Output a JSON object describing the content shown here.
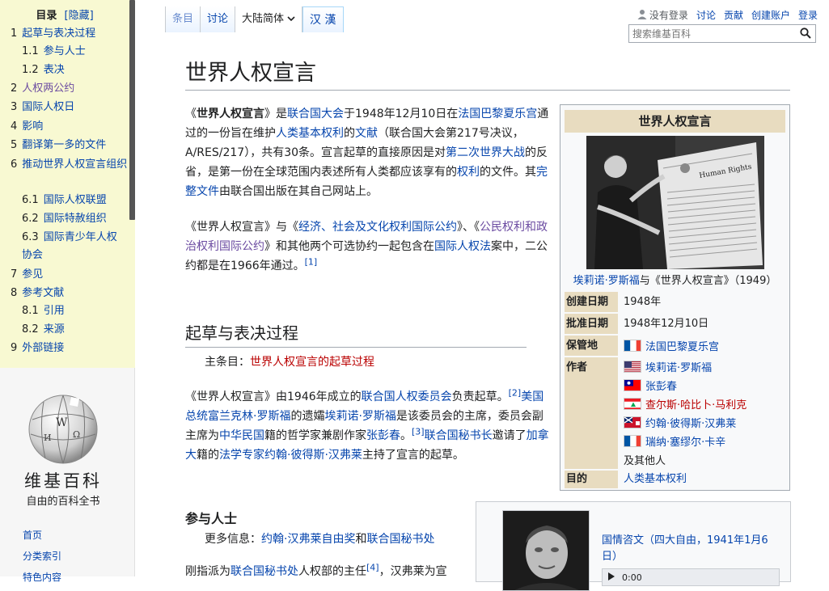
{
  "toc": {
    "title": "目录",
    "hide": "[隐藏]",
    "items": [
      {
        "num": "1",
        "label": "起草与表决过程",
        "visited": false
      },
      {
        "num": "1.1",
        "label": "参与人士",
        "visited": false
      },
      {
        "num": "1.2",
        "label": "表决",
        "visited": false
      },
      {
        "num": "2",
        "label": "人权两公约",
        "visited": true
      },
      {
        "num": "3",
        "label": "国际人权日",
        "visited": false
      },
      {
        "num": "4",
        "label": "影响",
        "visited": false
      },
      {
        "num": "5",
        "label": "翻译第一多的文件",
        "visited": false
      },
      {
        "num": "6",
        "label": "推动世界人权宣言组织",
        "visited": false
      },
      {
        "num": "6.1",
        "label": "国际人权联盟",
        "visited": false
      },
      {
        "num": "6.2",
        "label": "国际特赦组织",
        "visited": false
      },
      {
        "num": "6.3",
        "label": "国际青少年人权协会",
        "visited": false
      },
      {
        "num": "7",
        "label": "参见",
        "visited": false
      },
      {
        "num": "8",
        "label": "参考文献",
        "visited": false
      },
      {
        "num": "8.1",
        "label": "引用",
        "visited": false
      },
      {
        "num": "8.2",
        "label": "来源",
        "visited": false
      },
      {
        "num": "9",
        "label": "外部链接",
        "visited": false
      }
    ]
  },
  "logo": {
    "name": "维基百科",
    "tagline": "自由的百科全书"
  },
  "nav": [
    "首页",
    "分类索引",
    "特色内容"
  ],
  "tabs": {
    "article": "条目",
    "talk": "讨论",
    "variant": "大陆简体",
    "hanzi": "汉 漢"
  },
  "personal": {
    "not_logged_in": "没有登录",
    "talk": "讨论",
    "contributions": "贡献",
    "create_account": "创建账户",
    "login": "登录"
  },
  "search": {
    "placeholder": "搜索维基百科"
  },
  "article": {
    "title": "世界人权宣言",
    "p1": {
      "t1": "《",
      "bold": "世界人权宣言",
      "t2": "》是",
      "l1": "联合国大会",
      "t3": "于1948年12月10日在",
      "l2": "法国巴黎夏乐宫",
      "t4": "通过的一份旨在维护",
      "l3": "人类基本权利",
      "t5": "的",
      "l4": "文献",
      "t6": "（联合国大会第217号决议，A/RES/217），共有30条。宣言起草的直接原因是对",
      "l5": "第二次世界大战",
      "t7": "的反省，是第一份在全球范围内表述所有人类都应该享有的",
      "l6": "权利",
      "t8": "的文件。其",
      "l7": "完整文件",
      "t9": "由联合国出版在其自己网站上。"
    },
    "p2": {
      "t1": "《世界人权宣言》与《",
      "l1": "经济、社会及文化权利国际公约",
      "t2": "》、《",
      "l2": "公民权利和政治权利国际公约",
      "t3": "》和其他两个可选协约一起包含在",
      "l3": "国际人权法",
      "t4": "案中，二公约都是在1966年通过。",
      "ref": "[1]"
    },
    "section1": "起草与表决过程",
    "hatnote": {
      "label": "主条目：",
      "link": "世界人权宣言的起草过程"
    },
    "p3": {
      "t1": "《世界人权宣言》由1946年成立的",
      "l1": "联合国人权委员会",
      "t2": "负责起草。",
      "ref1": "[2]",
      "l2": "美国总统富兰克林·罗斯福",
      "t3": "的遗孀",
      "l3": "埃莉诺·罗斯福",
      "t4": "是该委员会的主席，委员会副主席为",
      "l4": "中华民国",
      "t5": "籍的哲学家兼剧作家",
      "l5": "张彭春",
      "t6": "。",
      "ref2": "[3]",
      "l6": "联合国秘书长",
      "t7": "邀请了",
      "l7": "加拿大",
      "t8": "籍的",
      "l8": "法学专家",
      "l9": "约翰·彼得斯·汉弗莱",
      "t9": "主持了宣言的起草。"
    },
    "section2": "参与人士",
    "more": {
      "label": "更多信息：",
      "l1": "约翰·汉弗莱自由奖",
      "t1": "和",
      "l2": "联合国秘书处"
    },
    "p4": {
      "t1": "刚指派为",
      "l1": "联合国秘书处",
      "t2": "人权部的主任",
      "ref": "[4]",
      "t3": "，汉弗莱为宣"
    }
  },
  "infobox": {
    "title": "世界人权宣言",
    "caption_link": "埃莉诺·罗斯福",
    "caption_rest": "与《世界人权宣言》（1949）",
    "photo_text": "Human Rights",
    "created_label": "创建日期",
    "created_value": "1948年",
    "ratified_label": "批准日期",
    "ratified_value": "1948年12月10日",
    "location_label": "保管地",
    "location_value": "法国巴黎夏乐宫",
    "authors_label": "作者",
    "authors": [
      "埃莉诺·罗斯福",
      "张彭春",
      "查尔斯·哈比卜·马利克",
      "约翰·彼得斯·汉弗莱",
      "瑞纳·塞缪尔·卡辛"
    ],
    "authors_more": "及其他人",
    "purpose_label": "目的",
    "purpose_value": "人类基本权利"
  },
  "soundbox": {
    "title": "国情咨文（四大自由，1941年1月6日）",
    "time": "0:00"
  }
}
